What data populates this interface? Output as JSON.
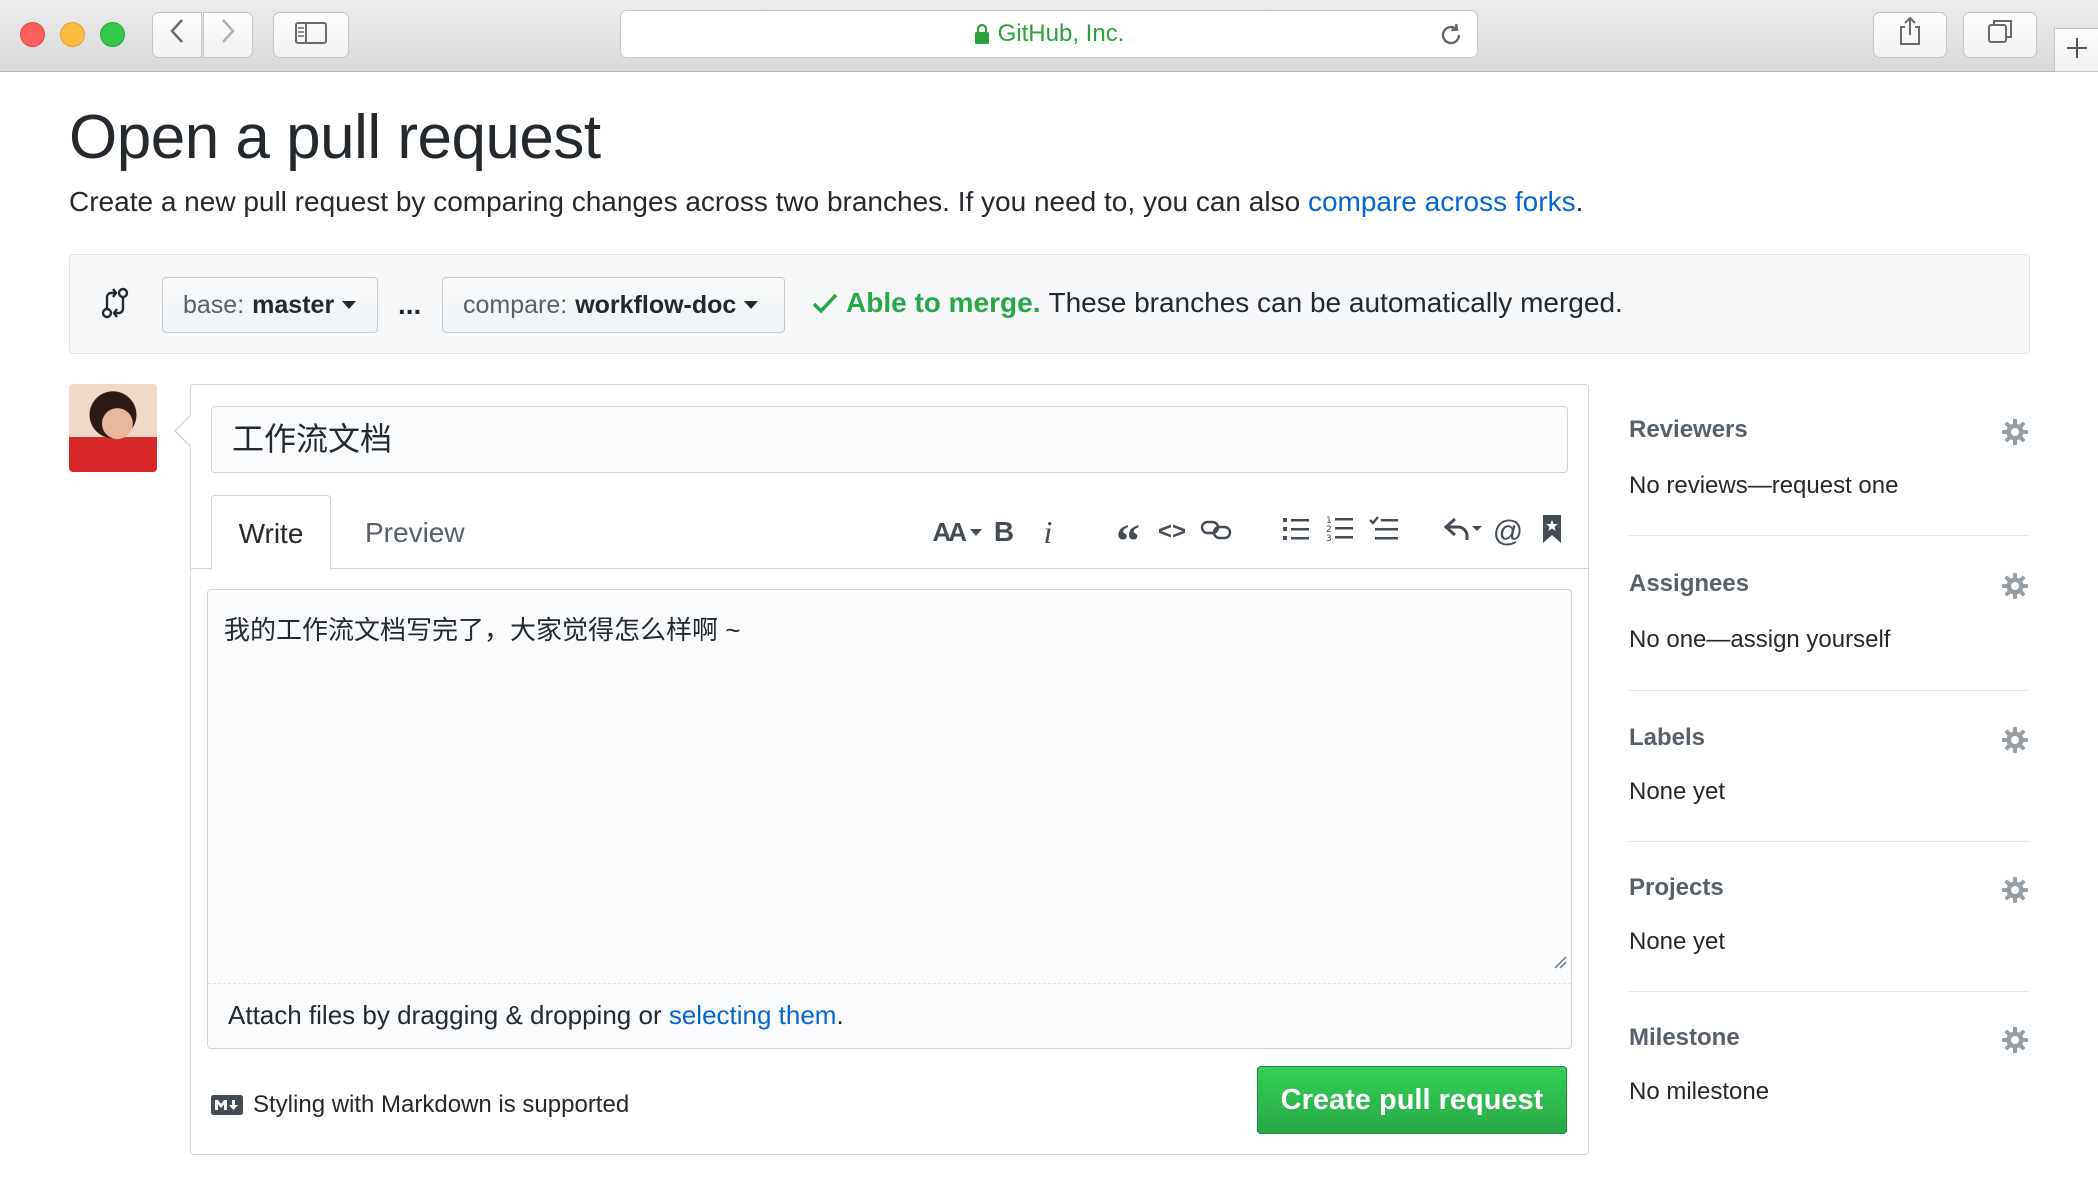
{
  "browser": {
    "url_text": "GitHub, Inc."
  },
  "page": {
    "title": "Open a pull request",
    "subtitle": "Create a new pull request by comparing changes across two branches. If you need to, you can also ",
    "subtitle_link": "compare across forks",
    "subtitle_end": "."
  },
  "range": {
    "base_label": "base:",
    "base_branch": "master",
    "separator": "...",
    "compare_label": "compare:",
    "compare_branch": "workflow-doc",
    "merge_ok": "Able to merge.",
    "merge_message": "These branches can be automatically merged."
  },
  "composer": {
    "title_value": "工作流文档",
    "tabs": [
      "Write",
      "Preview"
    ],
    "toolbar": {
      "header": "AA",
      "bold": "B",
      "italic": "i",
      "quote": "“",
      "code": "<>",
      "mention": "@"
    },
    "body_value": "我的工作流文档写完了，大家觉得怎么样啊 ~",
    "attach_text": "Attach files by dragging & dropping or ",
    "attach_link": "selecting them",
    "attach_end": ".",
    "markdown_note": "Styling with Markdown is supported",
    "submit_label": "Create pull request"
  },
  "sidebar": {
    "reviewers": {
      "heading": "Reviewers",
      "value": "No reviews—request one"
    },
    "assignees": {
      "heading": "Assignees",
      "value": "No one—assign yourself"
    },
    "labels": {
      "heading": "Labels",
      "value": "None yet"
    },
    "projects": {
      "heading": "Projects",
      "value": "None yet"
    },
    "milestone": {
      "heading": "Milestone",
      "value": "No milestone"
    }
  },
  "colors": {
    "link": "#0366d6",
    "success": "#28a745",
    "url_green": "#2aa13b"
  }
}
